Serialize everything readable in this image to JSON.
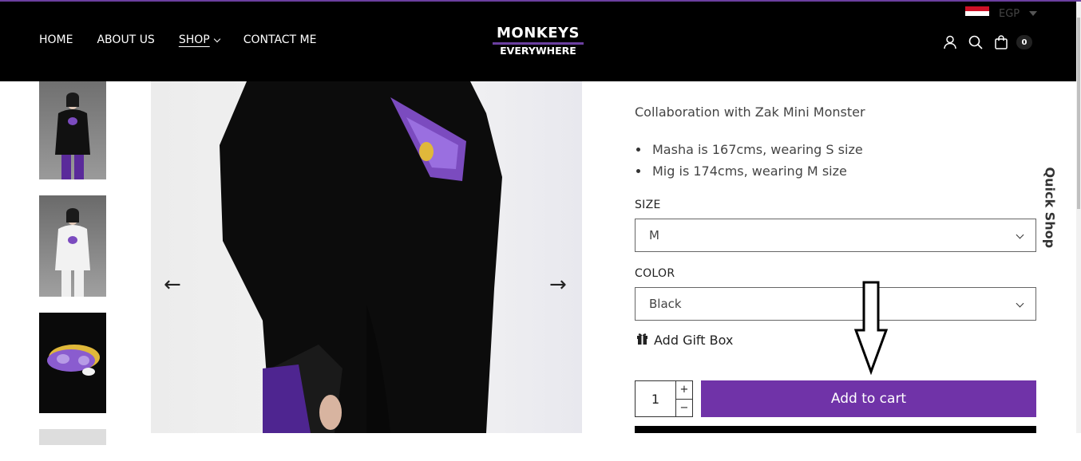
{
  "header": {
    "nav": [
      {
        "label": "HOME"
      },
      {
        "label": "ABOUT US"
      },
      {
        "label": "SHOP"
      },
      {
        "label": "CONTACT ME"
      }
    ],
    "logo_line1": "MONKEYS",
    "logo_line2": "EVERYWHERE",
    "currency": "EGP",
    "cart_count": "0"
  },
  "product": {
    "description": "Collaboration with Zak Mini Monster",
    "bullets": [
      "Masha is 167cms, wearing S size",
      "Mig is 174cms, wearing M size"
    ],
    "size_label": "SIZE",
    "size_value": "M",
    "color_label": "COLOR",
    "color_value": "Black",
    "gift_label": "Add Gift Box",
    "quantity": "1",
    "qty_plus": "+",
    "qty_minus": "−",
    "add_to_cart": "Add to cart"
  },
  "gallery": {
    "prev_arrow": "←",
    "next_arrow": "→"
  },
  "quick_shop": "Quick Shop",
  "colors": {
    "accent": "#7033a8",
    "header_bg": "#000000"
  }
}
